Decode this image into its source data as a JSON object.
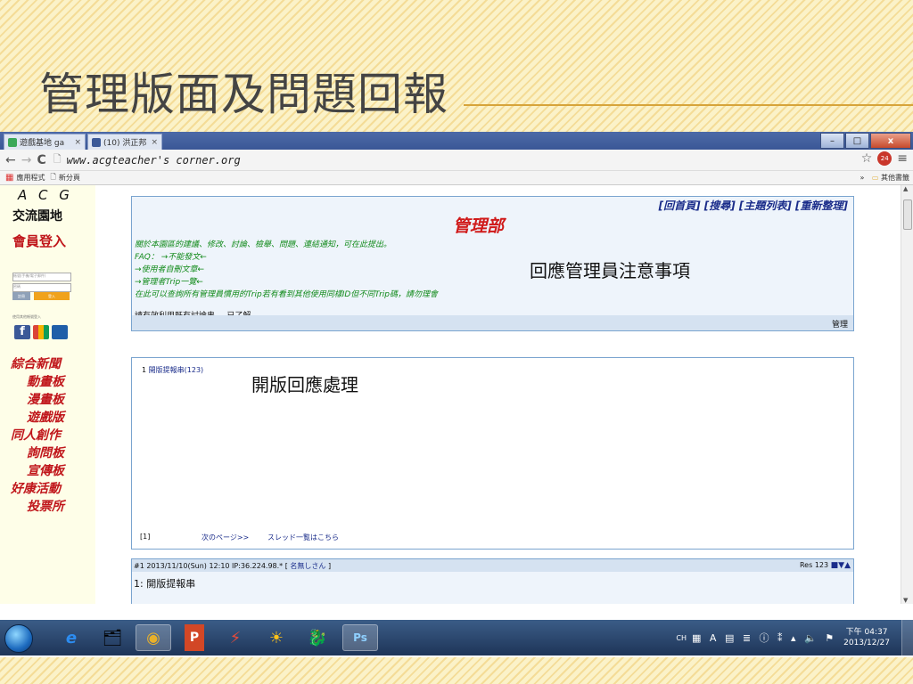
{
  "slide": {
    "title": "管理版面及問題回報"
  },
  "browser": {
    "tabs": [
      {
        "label": "遊戲基地 ga",
        "close": "×"
      },
      {
        "label": "(10) 洪正邦",
        "close": "×"
      }
    ],
    "window_controls": {
      "minimize": "–",
      "maximize": "□",
      "close": "x"
    },
    "nav": {
      "back": "←",
      "forward": "→",
      "reload": "C"
    },
    "url": "www.acgteacher's corner.org",
    "star": "☆",
    "ext_badge": "24",
    "menu": "≡",
    "bookmarks": {
      "apps": "應用程式",
      "new_tab": "新分頁",
      "chevron": "»",
      "other": "其他書籤"
    }
  },
  "sidebar": {
    "logo": "A C G",
    "forum": "交流園地",
    "login_title": "會員登入",
    "account_placeholder": "帳號(手機/電子郵件)",
    "password_placeholder": "密碼",
    "register_button": "註冊",
    "login_button": "登入",
    "small_text": "使用其他帳號登入",
    "nav": [
      "綜合新聞",
      "動畫板",
      "漫畫板",
      "遊戲版",
      "同人創作",
      "詢問板",
      "宣傳板",
      "好康活動",
      "投票所"
    ]
  },
  "panel1": {
    "links": "[回首頁] [搜尋] [主題列表] [重新整理]",
    "title": "管理部",
    "lines": [
      "關於本園區的建議、修改、討論、檢舉、問題、連結通知，可在此提出。",
      "FAQ： →不能發文←",
      "→使用者自刪文章←",
      "→管理者Trip一覽←",
      "在此可以查詢所有管理員慣用的Trip若有看到其他使用同樣ID但不同Trip碼，請勿理會"
    ],
    "note": "請有效利用既有討論串。　已了解。",
    "admin": "管理",
    "annotation": "回應管理員注意事項"
  },
  "panel2": {
    "item_number": "1",
    "item_link": "開版提報串(123)",
    "annotation": "開版回應處理",
    "page": "[1]",
    "next": "次のページ>>",
    "thread_list": "スレッド一覧はこちら"
  },
  "panel3": {
    "post_meta": "#1 2013/11/10(Sun) 12:10 IP:36.224.98.* [",
    "poster": "名無しさん",
    "meta_end": "]",
    "res": "Res 123",
    "res_arrows": "■▼▲",
    "subject": "1: 開版提報串"
  },
  "taskbar": {
    "apps": [
      "e",
      "🗂",
      "◉",
      "P",
      "⚡",
      "☀",
      "🐉",
      "Ps"
    ],
    "tray_lang": "CH",
    "tray_icons": "▦ A ▤ ≣ ⓘ ⁑ ▴ 🔈 ⚑",
    "time": "下午 04:37",
    "date": "2013/12/27"
  },
  "colors": {
    "accent_red": "#c0161b",
    "link_blue": "#1a2c8a",
    "green_text": "#118a1a",
    "panel_border": "#7aa4cf"
  }
}
